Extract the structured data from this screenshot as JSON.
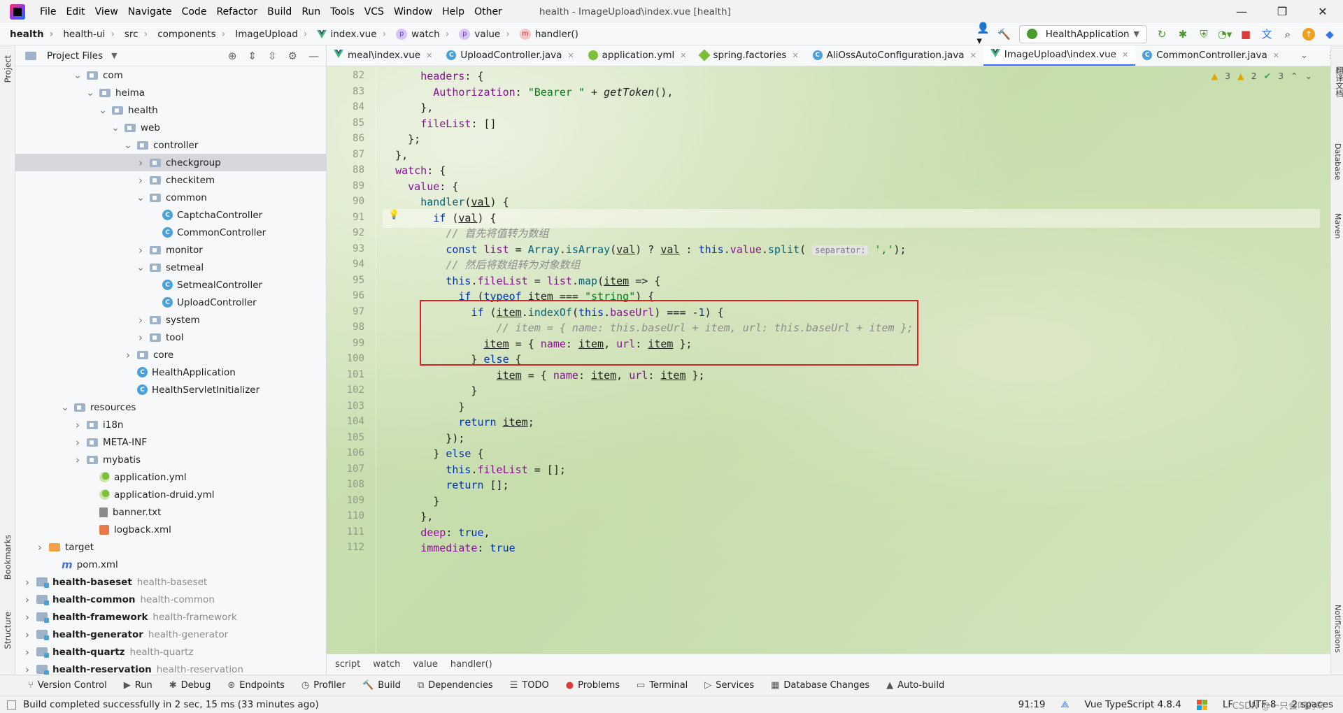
{
  "menu": [
    "File",
    "Edit",
    "View",
    "Navigate",
    "Code",
    "Refactor",
    "Build",
    "Run",
    "Tools",
    "VCS",
    "Window",
    "Help",
    "Other"
  ],
  "window_title": "health - ImageUpload\\index.vue [health]",
  "breadcrumbs": [
    "health",
    "health-ui",
    "src",
    "components",
    "ImageUpload",
    "index.vue",
    "watch",
    "value",
    "handler()"
  ],
  "run_config": "HealthApplication",
  "project_panel": {
    "title": "Project Files",
    "tree": [
      {
        "label": "com",
        "indent": 4,
        "icon": "folder",
        "arrow": "down"
      },
      {
        "label": "heima",
        "indent": 5,
        "icon": "folder",
        "arrow": "down"
      },
      {
        "label": "health",
        "indent": 6,
        "icon": "folder",
        "arrow": "down"
      },
      {
        "label": "web",
        "indent": 7,
        "icon": "folder",
        "arrow": "down"
      },
      {
        "label": "controller",
        "indent": 8,
        "icon": "folder",
        "arrow": "down"
      },
      {
        "label": "checkgroup",
        "indent": 9,
        "icon": "folder",
        "arrow": "right",
        "selected": true
      },
      {
        "label": "checkitem",
        "indent": 9,
        "icon": "folder",
        "arrow": "right"
      },
      {
        "label": "common",
        "indent": 9,
        "icon": "folder",
        "arrow": "down"
      },
      {
        "label": "CaptchaController",
        "indent": 10,
        "icon": "class"
      },
      {
        "label": "CommonController",
        "indent": 10,
        "icon": "class"
      },
      {
        "label": "monitor",
        "indent": 9,
        "icon": "folder",
        "arrow": "right"
      },
      {
        "label": "setmeal",
        "indent": 9,
        "icon": "folder",
        "arrow": "down"
      },
      {
        "label": "SetmealController",
        "indent": 10,
        "icon": "class"
      },
      {
        "label": "UploadController",
        "indent": 10,
        "icon": "class"
      },
      {
        "label": "system",
        "indent": 9,
        "icon": "folder",
        "arrow": "right"
      },
      {
        "label": "tool",
        "indent": 9,
        "icon": "folder",
        "arrow": "right"
      },
      {
        "label": "core",
        "indent": 8,
        "icon": "folder",
        "arrow": "right"
      },
      {
        "label": "HealthApplication",
        "indent": 8,
        "icon": "class"
      },
      {
        "label": "HealthServletInitializer",
        "indent": 8,
        "icon": "class"
      },
      {
        "label": "resources",
        "indent": 3,
        "icon": "folder",
        "arrow": "down"
      },
      {
        "label": "i18n",
        "indent": 4,
        "icon": "folder",
        "arrow": "right"
      },
      {
        "label": "META-INF",
        "indent": 4,
        "icon": "folder",
        "arrow": "right"
      },
      {
        "label": "mybatis",
        "indent": 4,
        "icon": "folder",
        "arrow": "right"
      },
      {
        "label": "application.yml",
        "indent": 5,
        "icon": "yml"
      },
      {
        "label": "application-druid.yml",
        "indent": 5,
        "icon": "yml"
      },
      {
        "label": "banner.txt",
        "indent": 5,
        "icon": "txt"
      },
      {
        "label": "logback.xml",
        "indent": 5,
        "icon": "xml"
      },
      {
        "label": "target",
        "indent": 1,
        "icon": "folder-orange",
        "arrow": "right"
      },
      {
        "label": "pom.xml",
        "indent": 2,
        "icon": "maven"
      },
      {
        "label": "health-baseset",
        "sub": "health-baseset",
        "indent": 0,
        "icon": "module",
        "arrow": "right",
        "bold": true
      },
      {
        "label": "health-common",
        "sub": "health-common",
        "indent": 0,
        "icon": "module",
        "arrow": "right",
        "bold": true
      },
      {
        "label": "health-framework",
        "sub": "health-framework",
        "indent": 0,
        "icon": "module",
        "arrow": "right",
        "bold": true
      },
      {
        "label": "health-generator",
        "sub": "health-generator",
        "indent": 0,
        "icon": "module",
        "arrow": "right",
        "bold": true
      },
      {
        "label": "health-quartz",
        "sub": "health-quartz",
        "indent": 0,
        "icon": "module",
        "arrow": "right",
        "bold": true
      },
      {
        "label": "health-reservation",
        "sub": "health-reservation",
        "indent": 0,
        "icon": "module",
        "arrow": "right",
        "bold": true
      }
    ]
  },
  "editor_tabs": [
    {
      "label": "meal\\index.vue",
      "icon": "vue"
    },
    {
      "label": "UploadController.java",
      "icon": "class"
    },
    {
      "label": "application.yml",
      "icon": "yml"
    },
    {
      "label": "spring.factories",
      "icon": "spring"
    },
    {
      "label": "AliOssAutoConfiguration.java",
      "icon": "class"
    },
    {
      "label": "ImageUpload\\index.vue",
      "icon": "vue",
      "active": true
    },
    {
      "label": "CommonController.java",
      "icon": "class"
    }
  ],
  "analysis": {
    "warnings": "3",
    "weak_warnings": "2",
    "ok": "3"
  },
  "code_lines": [
    {
      "n": "82",
      "html": "      <span class='prop'>headers</span>: {"
    },
    {
      "n": "83",
      "html": "        <span class='prop'>Authorization</span>: <span class='str'>\"Bearer \"</span> + <span class='it'>getToken</span>(),"
    },
    {
      "n": "84",
      "html": "      },"
    },
    {
      "n": "85",
      "html": "      <span class='prop'>fileList</span>: []"
    },
    {
      "n": "86",
      "html": "    };"
    },
    {
      "n": "87",
      "html": "  },"
    },
    {
      "n": "88",
      "html": "  <span class='prop'>watch</span>: {"
    },
    {
      "n": "89",
      "html": "    <span class='prop'>value</span>: {"
    },
    {
      "n": "90",
      "html": "      <span class='fn'>handler</span>(<span class='ul'>val</span>) {"
    },
    {
      "n": "91",
      "html": "        <span class='kw'>if</span> (<span class='ul'>val</span>) {"
    },
    {
      "n": "92",
      "html": "          <span class='cm'>// 首先将值转为数组</span>"
    },
    {
      "n": "93",
      "html": "          <span class='kw'>const</span> <span class='prop'>list</span> = <span class='fn'>Array</span>.<span class='fn'>isArray</span>(<span class='ul'>val</span>) ? <span class='ul'>val</span> : <span class='kw'>this</span>.<span class='prop'>value</span>.<span class='fn'>split</span>( <span class='hint'>separator:</span> <span class='str'>','</span>);"
    },
    {
      "n": "94",
      "html": "          <span class='cm'>// 然后将数组转为对象数组</span>"
    },
    {
      "n": "95",
      "html": "          <span class='kw'>this</span>.<span class='prop'>fileList</span> = <span class='prop'>list</span>.<span class='fn'>map</span>(<span class='ul'>item</span> => {"
    },
    {
      "n": "96",
      "html": "            <span class='kw'>if</span> (<span class='kw'>typeof</span> <span class='ul'>item</span> === <span class='str'>\"string\"</span>) {"
    },
    {
      "n": "97",
      "html": "              <span class='kw'>if</span> (<span class='ul'>item</span>.<span class='fn'>indexOf</span>(<span class='kw'>this</span>.<span class='prop'>baseUrl</span>) === -<span class='kw'>1</span>) {"
    },
    {
      "n": "98",
      "html": "                  <span class='cm'>// item = { name: this.baseUrl + item, url: this.baseUrl + item };</span>"
    },
    {
      "n": "99",
      "html": "                <span class='ul'>item</span> = { <span class='prop'>name</span>: <span class='ul'>item</span>, <span class='prop'>url</span>: <span class='ul'>item</span> };"
    },
    {
      "n": "100",
      "html": "              } <span class='kw'>else</span> {"
    },
    {
      "n": "101",
      "html": "                  <span class='ul'>item</span> = { <span class='prop'>name</span>: <span class='ul'>item</span>, <span class='prop'>url</span>: <span class='ul'>item</span> };"
    },
    {
      "n": "102",
      "html": "              }"
    },
    {
      "n": "103",
      "html": "            }"
    },
    {
      "n": "104",
      "html": "            <span class='kw'>return</span> <span class='ul'>item</span>;"
    },
    {
      "n": "105",
      "html": "          });"
    },
    {
      "n": "106",
      "html": "        } <span class='kw'>else</span> {"
    },
    {
      "n": "107",
      "html": "          <span class='kw'>this</span>.<span class='prop'>fileList</span> = [];"
    },
    {
      "n": "108",
      "html": "          <span class='kw'>return</span> [];"
    },
    {
      "n": "109",
      "html": "        }"
    },
    {
      "n": "110",
      "html": "      },"
    },
    {
      "n": "111",
      "html": "      <span class='prop'>deep</span>: <span class='kw'>true</span>,"
    },
    {
      "n": "112",
      "html": "      <span class='prop'>immediate</span>: <span class='kw'>true</span>"
    }
  ],
  "editor_breadcrumb": [
    "script",
    "watch",
    "value",
    "handler()"
  ],
  "tool_windows": [
    "Version Control",
    "Run",
    "Debug",
    "Endpoints",
    "Profiler",
    "Build",
    "Dependencies",
    "TODO",
    "Problems",
    "Terminal",
    "Services",
    "Database Changes",
    "Auto-build"
  ],
  "left_stripe": {
    "project": "Project",
    "bookmarks": "Bookmarks",
    "structure": "Structure"
  },
  "right_stripe": {
    "translate": "翻译文档",
    "database": "Database",
    "maven": "Maven",
    "notifications": "Notifications"
  },
  "status": {
    "message": "Build completed successfully in 2 sec, 15 ms (33 minutes ago)",
    "position": "91:19",
    "language": "Vue TypeScript 4.8.4",
    "line_sep": "LF",
    "encoding": "UTF-8",
    "indent": "2 spaces",
    "watermark": "CSDN @一只会叫的鸟"
  }
}
